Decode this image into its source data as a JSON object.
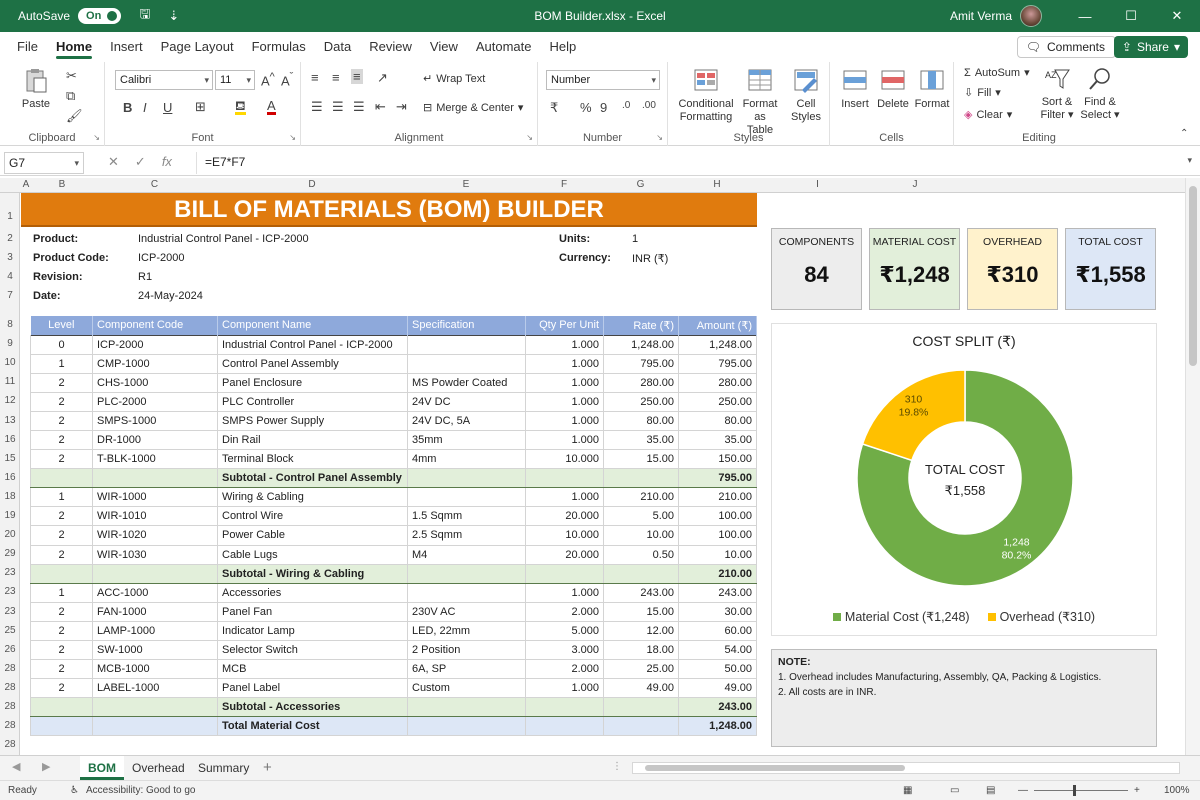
{
  "titlebar": {
    "autosave_label": "AutoSave",
    "autosave_state": "On",
    "file_title": "BOM Builder.xlsx - Excel",
    "user_name": "Amit Verma"
  },
  "menu": {
    "tabs": [
      "File",
      "Home",
      "Insert",
      "Page Layout",
      "Formulas",
      "Data",
      "Review",
      "View",
      "Automate",
      "Help"
    ],
    "active": "Home",
    "comments_label": "Comments",
    "share_label": "Share"
  },
  "ribbon": {
    "clipboard": {
      "paste": "Paste",
      "group": "Clipboard"
    },
    "font": {
      "name": "Calibri",
      "size": "11",
      "group": "Font"
    },
    "alignment": {
      "wrap": "Wrap Text",
      "merge": "Merge & Center",
      "group": "Alignment"
    },
    "number": {
      "format": "Number",
      "group": "Number"
    },
    "styles": {
      "cond_1": "Conditional",
      "cond_2": "Formatting",
      "fmt_1": "Format as",
      "fmt_2": "Table",
      "cell_1": "Cell",
      "cell_2": "Styles",
      "group": "Styles"
    },
    "cells": {
      "insert": "Insert",
      "delete": "Delete",
      "format": "Format",
      "group": "Cells"
    },
    "editing": {
      "autosum": "AutoSum",
      "fill": "Fill",
      "clear": "Clear",
      "sort_1": "Sort &",
      "sort_2": "Filter",
      "find_1": "Find &",
      "find_2": "Select",
      "group": "Editing"
    }
  },
  "formula_bar": {
    "cell_ref": "G7",
    "formula": "=E7*F7"
  },
  "col_headers": [
    "A",
    "B",
    "C",
    "D",
    "E",
    "F",
    "G",
    "H",
    "I",
    "J"
  ],
  "row_headers": [
    "1",
    "2",
    "3",
    "4",
    "7",
    "8",
    "9",
    "10",
    "11",
    "12",
    "13",
    "16",
    "15",
    "16",
    "18",
    "19",
    "20",
    "29",
    "23",
    "23",
    "23",
    "25",
    "26",
    "28",
    "28",
    "28",
    "28",
    "28"
  ],
  "sheet": {
    "title": "BILL OF MATERIALS (BOM) BUILDER",
    "meta": {
      "product_label": "Product:",
      "product_value": "Industrial Control Panel - ICP-2000",
      "code_label": "Product Code:",
      "code_value": "ICP-2000",
      "revision_label": "Revision:",
      "revision_value": "R1",
      "date_label": "Date:",
      "date_value": "24-May-2024",
      "units_label": "Units:",
      "units_value": "1",
      "currency_label": "Currency:",
      "currency_value": "INR (₹)"
    },
    "table_headers": [
      "Level",
      "Component Code",
      "Component Name",
      "Specification",
      "Qty Per Unit",
      "Rate (₹)",
      "Amount (₹)"
    ],
    "rows": [
      {
        "kind": "item",
        "cells": [
          "0",
          "ICP-2000",
          "Industrial Control Panel - ICP-2000",
          "",
          "1.000",
          "1,248.00",
          "1,248.00"
        ]
      },
      {
        "kind": "item",
        "cells": [
          "1",
          "CMP-1000",
          "Control Panel Assembly",
          "",
          "1.000",
          "795.00",
          "795.00"
        ]
      },
      {
        "kind": "item",
        "cells": [
          "2",
          "CHS-1000",
          "Panel Enclosure",
          "MS Powder Coated",
          "1.000",
          "280.00",
          "280.00"
        ]
      },
      {
        "kind": "item",
        "cells": [
          "2",
          "PLC-2000",
          "PLC Controller",
          "24V DC",
          "1.000",
          "250.00",
          "250.00"
        ]
      },
      {
        "kind": "item",
        "cells": [
          "2",
          "SMPS-1000",
          "SMPS Power Supply",
          "24V DC, 5A",
          "1.000",
          "80.00",
          "80.00"
        ]
      },
      {
        "kind": "item",
        "cells": [
          "2",
          "DR-1000",
          "Din Rail",
          "35mm",
          "1.000",
          "35.00",
          "35.00"
        ]
      },
      {
        "kind": "item",
        "cells": [
          "2",
          "T-BLK-1000",
          "Terminal Block",
          "4mm",
          "10.000",
          "15.00",
          "150.00"
        ]
      },
      {
        "kind": "sub",
        "cells": [
          "",
          "",
          "Subtotal - Control Panel Assembly",
          "",
          "",
          "",
          "795.00"
        ]
      },
      {
        "kind": "item",
        "cells": [
          "1",
          "WIR-1000",
          "Wiring & Cabling",
          "",
          "1.000",
          "210.00",
          "210.00"
        ]
      },
      {
        "kind": "item",
        "cells": [
          "2",
          "WIR-1010",
          "Control Wire",
          "1.5 Sqmm",
          "20.000",
          "5.00",
          "100.00"
        ]
      },
      {
        "kind": "item",
        "cells": [
          "2",
          "WIR-1020",
          "Power Cable",
          "2.5 Sqmm",
          "10.000",
          "10.00",
          "100.00"
        ]
      },
      {
        "kind": "item",
        "cells": [
          "2",
          "WIR-1030",
          "Cable Lugs",
          "M4",
          "20.000",
          "0.50",
          "10.00"
        ]
      },
      {
        "kind": "sub",
        "cells": [
          "",
          "",
          "Subtotal - Wiring & Cabling",
          "",
          "",
          "",
          "210.00"
        ]
      },
      {
        "kind": "item",
        "cells": [
          "1",
          "ACC-1000",
          "Accessories",
          "",
          "1.000",
          "243.00",
          "243.00"
        ]
      },
      {
        "kind": "item",
        "cells": [
          "2",
          "FAN-1000",
          "Panel Fan",
          "230V AC",
          "2.000",
          "15.00",
          "30.00"
        ]
      },
      {
        "kind": "item",
        "cells": [
          "2",
          "LAMP-1000",
          "Indicator Lamp",
          "LED, 22mm",
          "5.000",
          "12.00",
          "60.00"
        ]
      },
      {
        "kind": "item",
        "cells": [
          "2",
          "SW-1000",
          "Selector Switch",
          "2 Position",
          "3.000",
          "18.00",
          "54.00"
        ]
      },
      {
        "kind": "item",
        "cells": [
          "2",
          "MCB-1000",
          "MCB",
          "6A, SP",
          "2.000",
          "25.00",
          "50.00"
        ]
      },
      {
        "kind": "item",
        "cells": [
          "2",
          "LABEL-1000",
          "Panel Label",
          "Custom",
          "1.000",
          "49.00",
          "49.00"
        ]
      },
      {
        "kind": "sub",
        "cells": [
          "",
          "",
          "Subtotal - Accessories",
          "",
          "",
          "",
          "243.00"
        ]
      },
      {
        "kind": "total",
        "cells": [
          "",
          "",
          "Total Material Cost",
          "",
          "",
          "",
          "1,248.00"
        ]
      }
    ],
    "kpis": [
      {
        "label": "COMPONENTS",
        "value": "84",
        "color": "#ededed"
      },
      {
        "label": "MATERIAL COST",
        "value": "₹1,248",
        "color": "#e2efda"
      },
      {
        "label": "OVERHEAD",
        "value": "₹310",
        "color": "#fff2cc"
      },
      {
        "label": "TOTAL COST",
        "value": "₹1,558",
        "color": "#dde7f6"
      }
    ],
    "note": {
      "title": "NOTE:",
      "line1": "1. Overhead includes Manufacturing, Assembly, QA, Packing & Logistics.",
      "line2": "2. All costs are in INR."
    }
  },
  "chart_data": {
    "type": "pie",
    "title": "COST SPLIT (₹)",
    "categories": [
      "Material Cost",
      "Overhead"
    ],
    "values": [
      1248,
      310
    ],
    "percent_labels": [
      "80.2%",
      "19.8%"
    ],
    "colors": [
      "#70ad47",
      "#ffc000"
    ],
    "center_label": "TOTAL COST",
    "center_value": "₹1,558",
    "legend": [
      "Material Cost (₹1,248)",
      "Overhead (₹310)"
    ],
    "legend_position": "bottom"
  },
  "sheet_tabs": {
    "tabs": [
      "BOM",
      "Overhead",
      "Summary"
    ],
    "active": "BOM"
  },
  "statusbar": {
    "ready": "Ready",
    "accessibility": "Accessibility: Good to go",
    "zoom": "100%"
  }
}
